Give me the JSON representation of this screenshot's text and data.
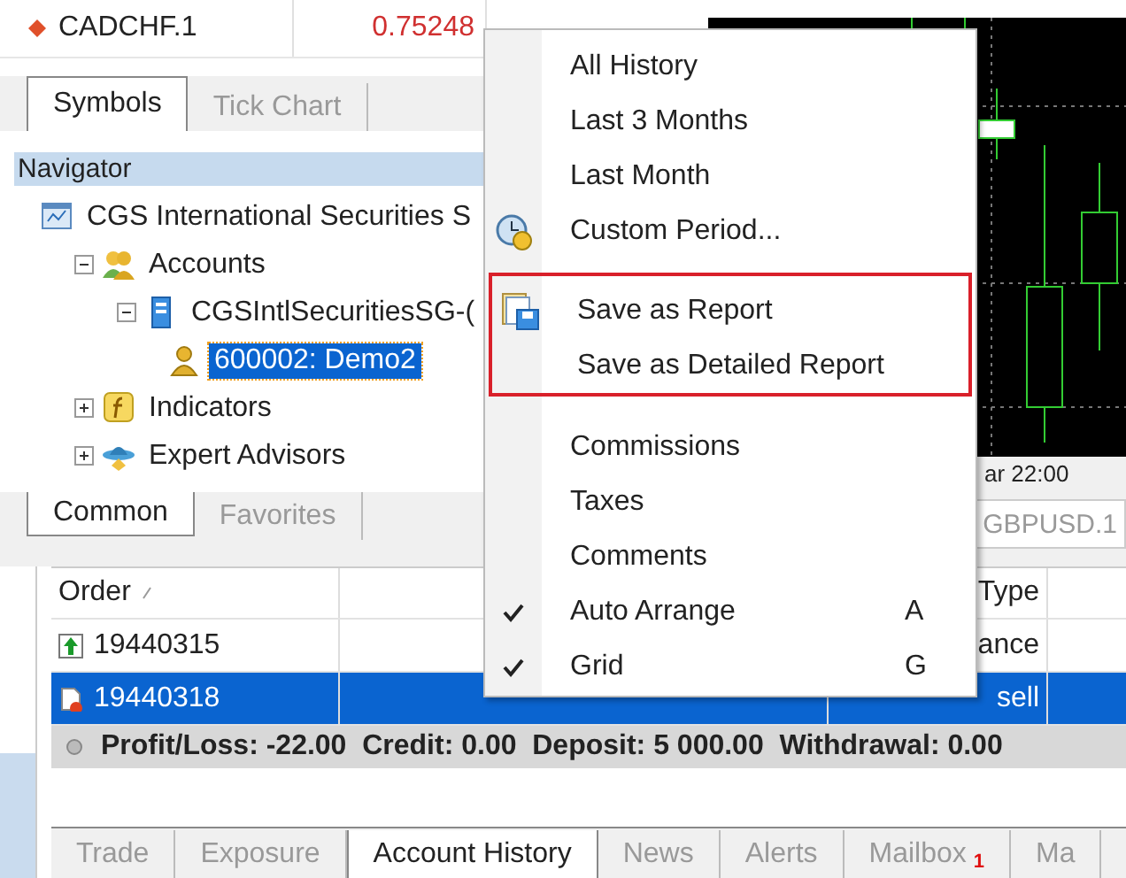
{
  "watch_row": {
    "symbol": "CADCHF.1",
    "bid": "0.75248"
  },
  "market_tabs": [
    {
      "label": "Symbols",
      "selected": true
    },
    {
      "label": "Tick Chart",
      "selected": false
    }
  ],
  "navigator": {
    "title": "Navigator",
    "tree": [
      {
        "label": "CGS International Securities S",
        "kind": "terminal",
        "selected": false,
        "children": [
          {
            "label": "Accounts",
            "kind": "accounts",
            "expanded": true,
            "selected": false,
            "children": [
              {
                "label": "CGSIntlSecuritiesSG-(",
                "kind": "server",
                "expanded": true,
                "selected": false,
                "children": [
                  {
                    "label": "600002: Demo2",
                    "kind": "account",
                    "selected": true
                  }
                ]
              }
            ]
          },
          {
            "label": "Indicators",
            "kind": "indicators",
            "expanded": false,
            "selected": false
          },
          {
            "label": "Expert Advisors",
            "kind": "experts",
            "expanded": false,
            "selected": false
          }
        ]
      }
    ]
  },
  "navigator_tabs": [
    {
      "label": "Common",
      "selected": true
    },
    {
      "label": "Favorites",
      "selected": false
    }
  ],
  "chart": {
    "time_label": "ar 22:00"
  },
  "chart_tabs": [
    {
      "label": "GBPUSD.1",
      "selected": false
    }
  ],
  "context_menu": {
    "items": [
      {
        "kind": "plain",
        "label": "All History"
      },
      {
        "kind": "plain",
        "label": "Last 3 Months"
      },
      {
        "kind": "plain",
        "label": "Last Month"
      },
      {
        "kind": "period",
        "label": "Custom Period..."
      },
      {
        "kind": "separator"
      },
      {
        "kind": "report",
        "label": "Save as Report",
        "outlined": true
      },
      {
        "kind": "plain",
        "label": "Save as Detailed Report",
        "outlined": true
      },
      {
        "kind": "separator"
      },
      {
        "kind": "plain",
        "label": "Commissions"
      },
      {
        "kind": "plain",
        "label": "Taxes"
      },
      {
        "kind": "plain",
        "label": "Comments"
      },
      {
        "kind": "check",
        "label": "Auto Arrange",
        "checked": true,
        "shortcut": "A"
      },
      {
        "kind": "check",
        "label": "Grid",
        "checked": true,
        "shortcut": "G"
      }
    ]
  },
  "history_table": {
    "columns": {
      "order": "Order",
      "type": "Type"
    },
    "rows": [
      {
        "kind": "deposit",
        "order": "19440315",
        "type": "ance",
        "selected": false
      },
      {
        "kind": "deal",
        "order": "19440318",
        "type": "sell",
        "selected": true
      }
    ],
    "summary": "Profit/Loss: -22.00  Credit: 0.00  Deposit: 5 000.00  Withdrawal: 0.00"
  },
  "terminal_tabs": [
    {
      "label": "Trade",
      "selected": false
    },
    {
      "label": "Exposure",
      "selected": false
    },
    {
      "label": "Account History",
      "selected": true
    },
    {
      "label": "News",
      "selected": false
    },
    {
      "label": "Alerts",
      "selected": false
    },
    {
      "label": "Mailbox",
      "badge": "1",
      "selected": false
    },
    {
      "label": "Ma",
      "selected": false
    }
  ]
}
